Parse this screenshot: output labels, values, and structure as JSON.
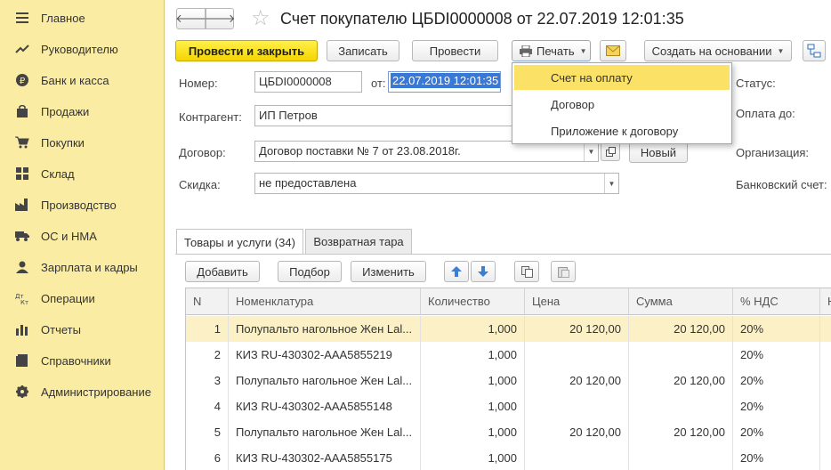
{
  "sidebar": {
    "items": [
      {
        "label": "Главное",
        "icon": "menu-icon"
      },
      {
        "label": "Руководителю",
        "icon": "trend-icon"
      },
      {
        "label": "Банк и касса",
        "icon": "ruble-coin-icon"
      },
      {
        "label": "Продажи",
        "icon": "shopping-bag-icon"
      },
      {
        "label": "Покупки",
        "icon": "cart-icon"
      },
      {
        "label": "Склад",
        "icon": "warehouse-icon"
      },
      {
        "label": "Производство",
        "icon": "factory-icon"
      },
      {
        "label": "ОС и НМА",
        "icon": "truck-icon"
      },
      {
        "label": "Зарплата и кадры",
        "icon": "person-icon"
      },
      {
        "label": "Операции",
        "icon": "dt-kt-icon"
      },
      {
        "label": "Отчеты",
        "icon": "bar-chart-icon"
      },
      {
        "label": "Справочники",
        "icon": "book-icon"
      },
      {
        "label": "Администрирование",
        "icon": "gear-icon"
      }
    ]
  },
  "header": {
    "title": "Счет покупателю ЦБDI0000008 от 22.07.2019 12:01:35",
    "back_glyph": "🡐",
    "forward_glyph": "🡒",
    "star_glyph": "☆"
  },
  "toolbar": {
    "post_close": "Провести и закрыть",
    "save": "Записать",
    "post": "Провести",
    "print": "Печать",
    "create_based": "Создать на основании"
  },
  "print_menu": {
    "items": [
      "Счет на оплату",
      "Договор",
      "Приложение к договору"
    ],
    "active_index": 0
  },
  "form": {
    "number_label": "Номер:",
    "number_value": "ЦБDI0000008",
    "date_label": "от:",
    "date_value": "22.07.2019 12:01:35",
    "counterparty_label": "Контрагент:",
    "counterparty_value": "ИП Петров",
    "contract_label": "Договор:",
    "contract_value": "Договор поставки № 7 от 23.08.2018г.",
    "new_button": "Новый",
    "discount_label": "Скидка:",
    "discount_value": "не предоставлена",
    "status_label": "Статус:",
    "pay_until_label": "Оплата до:",
    "org_label": "Организация:",
    "bank_label": "Банковский счет:"
  },
  "tabs": [
    {
      "label": "Товары и услуги (34)",
      "active": true
    },
    {
      "label": "Возвратная тара",
      "active": false
    }
  ],
  "table_toolbar": {
    "add": "Добавить",
    "pick": "Подбор",
    "edit": "Изменить"
  },
  "table": {
    "columns": [
      "N",
      "Номенклатура",
      "Количество",
      "Цена",
      "Сумма",
      "% НДС",
      "Н"
    ],
    "rows": [
      {
        "n": "1",
        "name": "Полупальто нагольное Жен Lal...",
        "qty": "1,000",
        "price": "20 120,00",
        "sum": "20 120,00",
        "vat": "20%"
      },
      {
        "n": "2",
        "name": "КИЗ RU-430302-ААА5855219",
        "qty": "1,000",
        "price": "",
        "sum": "",
        "vat": "20%"
      },
      {
        "n": "3",
        "name": "Полупальто нагольное Жен Lal...",
        "qty": "1,000",
        "price": "20 120,00",
        "sum": "20 120,00",
        "vat": "20%"
      },
      {
        "n": "4",
        "name": "КИЗ RU-430302-ААА5855148",
        "qty": "1,000",
        "price": "",
        "sum": "",
        "vat": "20%"
      },
      {
        "n": "5",
        "name": "Полупальто нагольное Жен Lal...",
        "qty": "1,000",
        "price": "20 120,00",
        "sum": "20 120,00",
        "vat": "20%"
      },
      {
        "n": "6",
        "name": "КИЗ RU-430302-ААА5855175",
        "qty": "1,000",
        "price": "",
        "sum": "",
        "vat": "20%"
      }
    ],
    "selected_index": 0
  },
  "colors": {
    "sidebar_bg": "#fbeca4",
    "primary_button": "#f5d500",
    "menu_highlight": "#fbe266",
    "selected_row": "#fcf1c6",
    "date_highlight": "#3a78d6",
    "arrow_icon": "#3a7fd5"
  }
}
